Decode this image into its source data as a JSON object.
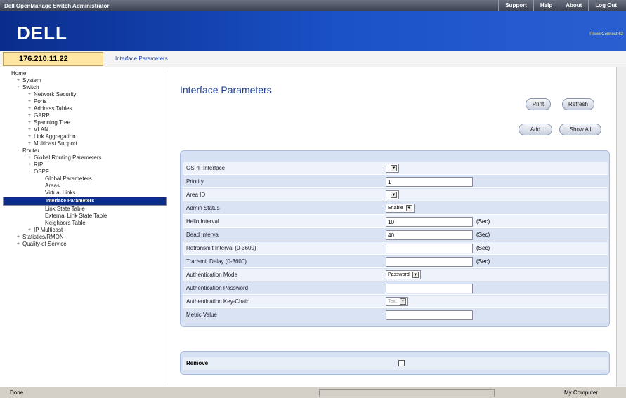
{
  "topbar": {
    "title": "Dell OpenManage Switch Administrator",
    "links": [
      "Support",
      "Help",
      "About",
      "Log Out"
    ]
  },
  "banner": {
    "logo": "DELL",
    "product": "PowerConnect 62"
  },
  "ipbar": {
    "ip": "176.210.11.22",
    "breadcrumb": "Interface Parameters"
  },
  "tree": [
    {
      "label": "Home",
      "depth": 0,
      "exp": ""
    },
    {
      "label": "System",
      "depth": 1,
      "exp": "+"
    },
    {
      "label": "Switch",
      "depth": 1,
      "exp": "-"
    },
    {
      "label": "Network Security",
      "depth": 2,
      "exp": "+"
    },
    {
      "label": "Ports",
      "depth": 2,
      "exp": "+"
    },
    {
      "label": "Address Tables",
      "depth": 2,
      "exp": "+"
    },
    {
      "label": "GARP",
      "depth": 2,
      "exp": "+"
    },
    {
      "label": "Spanning Tree",
      "depth": 2,
      "exp": "+"
    },
    {
      "label": "VLAN",
      "depth": 2,
      "exp": "+"
    },
    {
      "label": "Link Aggregation",
      "depth": 2,
      "exp": "+"
    },
    {
      "label": "Multicast Support",
      "depth": 2,
      "exp": "+"
    },
    {
      "label": "Router",
      "depth": 1,
      "exp": "-"
    },
    {
      "label": "Global Routing Parameters",
      "depth": 2,
      "exp": "+"
    },
    {
      "label": "RIP",
      "depth": 2,
      "exp": "+"
    },
    {
      "label": "OSPF",
      "depth": 2,
      "exp": "-"
    },
    {
      "label": "Global Parameters",
      "depth": 3,
      "exp": ""
    },
    {
      "label": "Areas",
      "depth": 3,
      "exp": ""
    },
    {
      "label": "Virtual Links",
      "depth": 3,
      "exp": ""
    },
    {
      "label": "Interface Parameters",
      "depth": 3,
      "exp": "",
      "selected": true
    },
    {
      "label": "Link State Table",
      "depth": 3,
      "exp": ""
    },
    {
      "label": "External Link State Table",
      "depth": 3,
      "exp": ""
    },
    {
      "label": "Neighbors Table",
      "depth": 3,
      "exp": ""
    },
    {
      "label": "IP Multicast",
      "depth": 2,
      "exp": "+"
    },
    {
      "label": "Statistics/RMON",
      "depth": 1,
      "exp": "+"
    },
    {
      "label": "Quality of Service",
      "depth": 1,
      "exp": "+"
    }
  ],
  "main": {
    "title": "Interface Parameters",
    "buttons": {
      "print": "Print",
      "refresh": "Refresh",
      "add": "Add",
      "show_all": "Show All"
    },
    "fields": [
      {
        "label": "OSPF Interface",
        "type": "select",
        "value": "",
        "unit": ""
      },
      {
        "label": "Priority",
        "type": "input",
        "value": "1",
        "unit": ""
      },
      {
        "label": "Area ID",
        "type": "select",
        "value": "",
        "unit": ""
      },
      {
        "label": "Admin Status",
        "type": "select",
        "value": "Enable",
        "unit": ""
      },
      {
        "label": "Hello Interval",
        "type": "input",
        "value": "10",
        "unit": "(Sec)"
      },
      {
        "label": "Dead Interval",
        "type": "input",
        "value": "40",
        "unit": "(Sec)"
      },
      {
        "label": "Retransmit Interval (0-3600)",
        "type": "input",
        "value": "",
        "unit": "(Sec)"
      },
      {
        "label": "Transmit Delay (0-3600)",
        "type": "input",
        "value": "",
        "unit": "(Sec)"
      },
      {
        "label": "Authentication Mode",
        "type": "select",
        "value": "Password",
        "unit": ""
      },
      {
        "label": "Authentication Password",
        "type": "input",
        "value": "",
        "unit": ""
      },
      {
        "label": "Authentication Key-Chain",
        "type": "select",
        "value": "Text",
        "unit": "",
        "disabled": true
      },
      {
        "label": "Metric Value",
        "type": "input",
        "value": "",
        "unit": ""
      }
    ],
    "remove_label": "Remove"
  },
  "status": {
    "text": "Done",
    "zone": "My Computer"
  }
}
